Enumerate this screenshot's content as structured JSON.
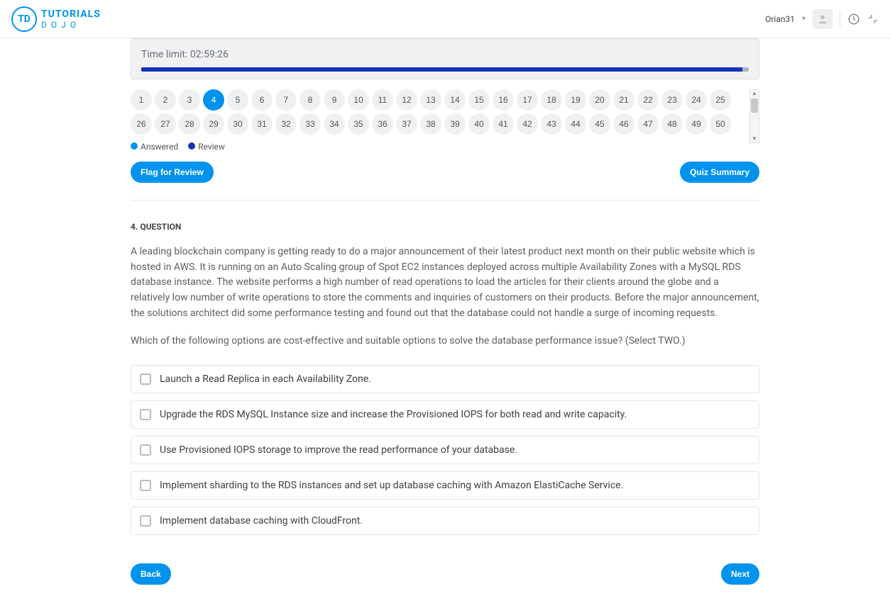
{
  "header": {
    "logo_initials": "TD",
    "logo_top": "TUTORIALS",
    "logo_bottom": "DOJO",
    "username": "Orian31"
  },
  "timer": {
    "label": "Time limit: 02:59:26",
    "progress_pct": 99
  },
  "question_nav": {
    "ids": [
      1,
      2,
      3,
      4,
      5,
      6,
      7,
      8,
      9,
      10,
      11,
      12,
      13,
      14,
      15,
      16,
      17,
      18,
      19,
      20,
      21,
      22,
      23,
      24,
      25,
      26,
      27,
      28,
      29,
      30,
      31,
      32,
      33,
      34,
      35,
      36,
      37,
      38,
      39,
      40,
      41,
      42,
      43,
      44,
      45,
      46,
      47,
      48,
      49,
      50
    ],
    "active": 4
  },
  "legend": {
    "answered": "Answered",
    "review": "Review"
  },
  "actions": {
    "flag": "Flag for Review",
    "summary": "Quiz Summary"
  },
  "question": {
    "number": 4,
    "heading": "4. QUESTION",
    "paragraph1": "A leading blockchain company is getting ready to do a major announcement of their latest product next month on their public website which is hosted in AWS. It is running on an Auto Scaling group of Spot EC2 instances deployed across multiple Availability Zones with a MySQL RDS database instance. The website performs a high number of read operations to load the articles for their clients around the globe and a relatively low number of write operations to store the comments and inquiries of customers on their products. Before the major announcement, the solutions architect did some performance testing and found out that the database could not handle a surge of incoming requests.",
    "paragraph2": "Which of the following options are cost-effective and suitable options to solve the database performance issue? (Select TWO.)",
    "options": [
      "Launch a Read Replica in each Availability Zone.",
      "Upgrade the RDS MySQL Instance size and increase the Provisioned IOPS for both read and write capacity.",
      "Use Provisioned IOPS storage to improve the read performance of your database.",
      "Implement sharding to the RDS instances and set up database caching with Amazon ElastiCache Service.",
      "Implement database caching with CloudFront."
    ]
  },
  "nav": {
    "back": "Back",
    "next": "Next"
  },
  "colors": {
    "brand": "#0093ee",
    "review_dot": "#1233b8"
  }
}
